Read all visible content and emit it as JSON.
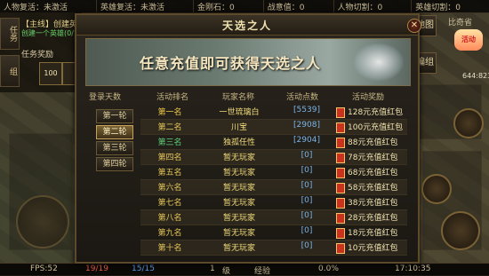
{
  "topbar": {
    "cells": [
      "人物复活：未激活",
      "英雄复活：未激活",
      "金刚石：0",
      "战意值：0",
      "人物切割：0",
      "英雄切割：0"
    ]
  },
  "quest": {
    "title": "【主线】创建英",
    "progress": "创建一个英雄(0/1",
    "reward_label": "任务奖励",
    "reward_value": "100",
    "side_tab": "任务",
    "side_tab2": "组"
  },
  "right": {
    "tab_map": "地图",
    "tab_group": "编组",
    "map_name": "比奇省",
    "gift_label": "活动",
    "coords": "644:823"
  },
  "modal": {
    "title": "天选之人",
    "close": "✕",
    "banner_text": "任意充值即可获得天选之人",
    "headers": {
      "round": "登录天数",
      "rank": "活动排名",
      "player": "玩家名称",
      "points": "活动点数",
      "reward": "活动奖励"
    },
    "rounds": [
      "第一轮",
      "第二轮",
      "第三轮",
      "第四轮"
    ],
    "active_round_index": 1,
    "rows": [
      {
        "rank": "第一名",
        "player": "一世琉璃白",
        "points": "[5539]",
        "reward": "128元充值红包"
      },
      {
        "rank": "第二名",
        "player": "川宝",
        "points": "[2908]",
        "reward": "100元充值红包"
      },
      {
        "rank": "第三名",
        "player": "独孤任性",
        "points": "[2904]",
        "reward": "88元充值红包"
      },
      {
        "rank": "第四名",
        "player": "暂无玩家",
        "points": "[0]",
        "reward": "78元充值红包"
      },
      {
        "rank": "第五名",
        "player": "暂无玩家",
        "points": "[0]",
        "reward": "68元充值红包"
      },
      {
        "rank": "第六名",
        "player": "暂无玩家",
        "points": "[0]",
        "reward": "58元充值红包"
      },
      {
        "rank": "第七名",
        "player": "暂无玩家",
        "points": "[0]",
        "reward": "38元充值红包"
      },
      {
        "rank": "第八名",
        "player": "暂无玩家",
        "points": "[0]",
        "reward": "28元充值红包"
      },
      {
        "rank": "第九名",
        "player": "暂无玩家",
        "points": "[0]",
        "reward": "18元充值红包"
      },
      {
        "rank": "第十名",
        "player": "暂无玩家",
        "points": "[0]",
        "reward": "10元充值红包"
      }
    ],
    "rank_colors": [
      "#f0c84a",
      "#e8c85a",
      "#5fd07a",
      "#e8c85a",
      "#e8c85a",
      "#e8c85a",
      "#e8c85a",
      "#e8c85a",
      "#e8c85a",
      "#e8c85a"
    ]
  },
  "bottombar": {
    "fps": "FPS:52",
    "hp": "19/19",
    "mp": "15/15",
    "level": "1",
    "level_label": "级",
    "exp_label": "经验",
    "exp_value": "0.0%",
    "time": "17:10:35"
  }
}
